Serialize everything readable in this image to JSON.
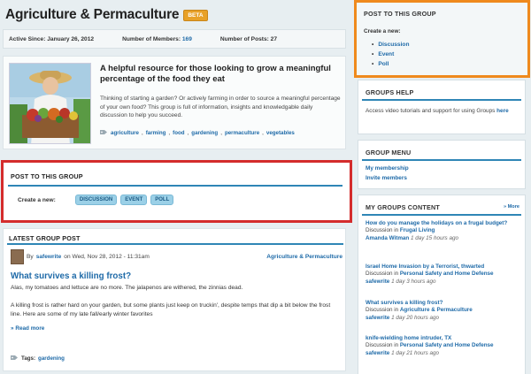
{
  "group": {
    "title": "Agriculture & Permaculture",
    "badge": "BETA",
    "active_label": "Active Since:",
    "active_date": "January 26, 2012",
    "members_label": "Number of Members:",
    "members_count": "169",
    "posts_label": "Number of Posts:",
    "posts_count": "27"
  },
  "about": {
    "heading": "A helpful resource for those looking to grow a meaningful percentage of the food they eat",
    "body": "Thinking of starting a garden? Or actively farming in order to source a meaningful percentage of your own food? This group is full of information, insights and knowledgable daily discussion to help you succeed.",
    "tags": [
      "agriculture",
      "farming",
      "food",
      "gardening",
      "permaculture",
      "vegetables"
    ]
  },
  "post_to_group_left": {
    "title": "POST TO THIS GROUP",
    "create_label": "Create a new:",
    "buttons": [
      "DISCUSSION",
      "EVENT",
      "POLL"
    ]
  },
  "latest_post": {
    "section_title": "LATEST GROUP POST",
    "by": "By",
    "author": "safewrite",
    "date": "on Wed, Nov 28, 2012 - 11:31am",
    "category": "Agriculture & Permaculture",
    "title": "What survives a killing frost?",
    "p1": "Alas, my tomatoes and lettuce are no more. The jalapenos are withered, the zinnias dead.",
    "p2": "A killing frost is rather hard on your garden, but some plants just keep on truckin', despite temps that dip a bit below the frost line. Here are some of my late fall/early winter favorites",
    "read_more": "» Read more",
    "tags_label": "Tags:",
    "tags": [
      "gardening"
    ]
  },
  "post_to_group_right": {
    "title": "POST TO THIS GROUP",
    "create_label": "Create a new:",
    "items": [
      "Discussion",
      "Event",
      "Poll"
    ]
  },
  "groups_help": {
    "title": "GROUPS HELP",
    "text": "Access video tutorials and support for using Groups",
    "link": "here"
  },
  "group_menu": {
    "title": "GROUP MENU",
    "items": [
      "My membership",
      "Invite members"
    ]
  },
  "my_groups_content": {
    "title": "MY GROUPS CONTENT",
    "more": "» More",
    "items": [
      {
        "title": "How do you manage the holidays on a frugal budget?",
        "type_text": "Discussion in",
        "group": "Frugal Living",
        "user": "Amanda Witman",
        "time": "1 day 15 hours ago"
      },
      {
        "title": "Israel Home Invasion by a Terrorist, thwarted",
        "type_text": "Discussion in",
        "group": "Personal Safety and Home Defense",
        "user": "safewrite",
        "time": "1 day 3 hours ago"
      },
      {
        "title": "What survives a killing frost?",
        "type_text": "Discussion in",
        "group": "Agriculture & Permaculture",
        "user": "safewrite",
        "time": "1 day 20 hours ago"
      },
      {
        "title": "knife-wielding home intruder, TX",
        "type_text": "Discussion in",
        "group": "Personal Safety and Home Defense",
        "user": "safewrite",
        "time": "1 day 21 hours ago"
      }
    ]
  }
}
